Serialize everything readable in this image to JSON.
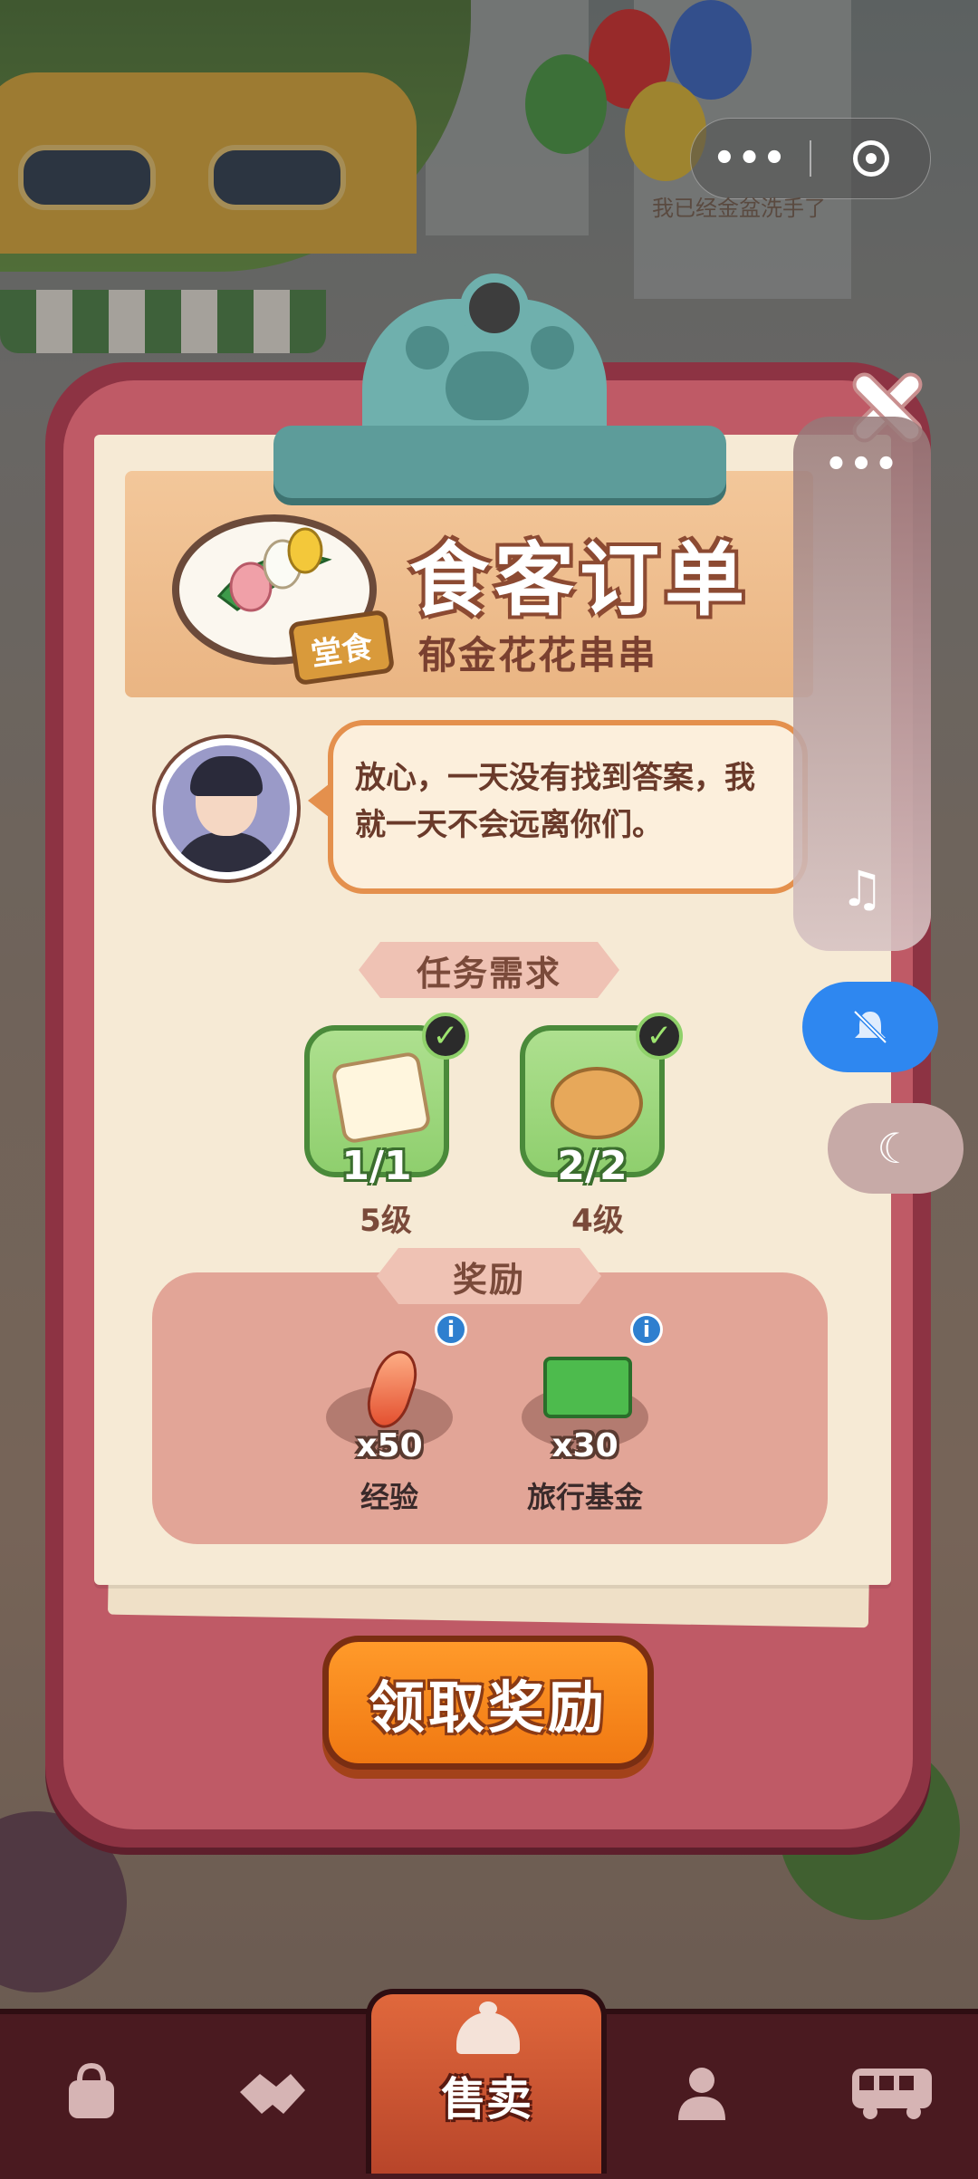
{
  "capsule": {
    "more_glyph": "•••",
    "status_text": "我已经金盆洗手了"
  },
  "order": {
    "title": "食客订单",
    "dish_name": "郁金花花串串",
    "dine_tag": "堂食",
    "speech": "放心，一天没有找到答案，我就一天不会远离你们。"
  },
  "requirements": {
    "label": "任务需求",
    "items": [
      {
        "icon": "tofu-icon",
        "count": "1/1",
        "level": "5级",
        "done": true
      },
      {
        "icon": "bread-icon",
        "count": "2/2",
        "level": "4级",
        "done": true
      }
    ]
  },
  "rewards": {
    "label": "奖励",
    "items": [
      {
        "icon": "gem-icon",
        "amount": "x50",
        "name": "经验"
      },
      {
        "icon": "cash-icon",
        "amount": "x30",
        "name": "旅行基金"
      }
    ]
  },
  "claim_button": "领取奖励",
  "sidebar": {
    "dots": "•••",
    "music_icon": "music-icon",
    "mute_icon": "bell-off-icon",
    "night_icon": "moon-icon"
  },
  "bottom_nav": {
    "items": [
      {
        "icon": "bag-icon"
      },
      {
        "icon": "handshake-icon"
      },
      {
        "icon": "bell-icon",
        "label": "售卖"
      },
      {
        "icon": "profile-icon"
      },
      {
        "icon": "bus-icon"
      }
    ]
  },
  "colors": {
    "panel": "#8d3343",
    "paper": "#f6ead5",
    "claim": "#f07812",
    "accent_blue": "#2e87f0"
  }
}
